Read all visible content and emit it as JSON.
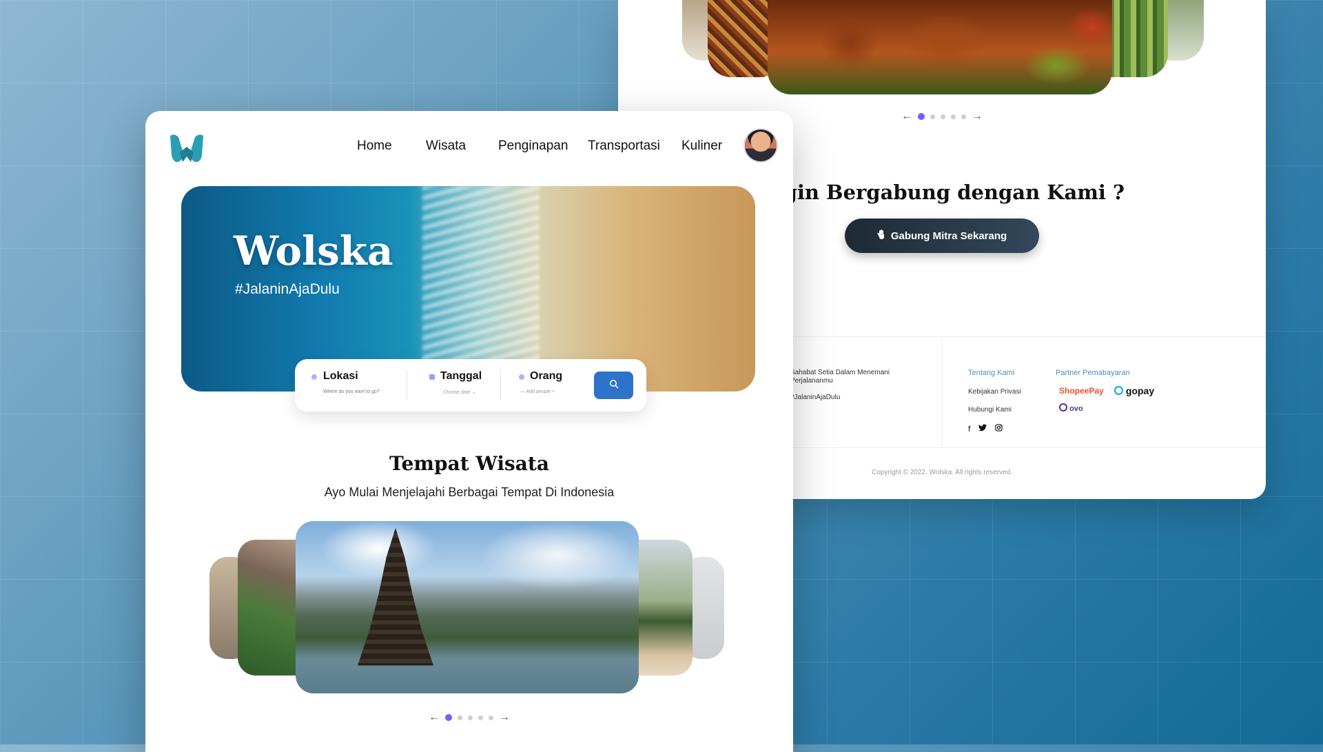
{
  "hero": {
    "title": "Wolska",
    "hashtag": "#JalaninAjaDulu"
  },
  "nav": {
    "items": [
      "Home",
      "Wisata",
      "Penginapan",
      "Transportasi",
      "Kuliner"
    ]
  },
  "search": {
    "location_label": "Lokasi",
    "location_placeholder": "Where do you want to go?",
    "date_label": "Tanggal",
    "date_placeholder": "Choose date",
    "people_label": "Orang",
    "people_placeholder": "Add people"
  },
  "section": {
    "title": "Tempat Wisata",
    "subtitle": "Ayo Mulai Menjelajahi Berbagai Tempat Di Indonesia"
  },
  "carousel": {
    "prev_arrow": "←",
    "next_arrow": "→",
    "pages": 5,
    "active_index": 0
  },
  "join": {
    "title": "Ingin Bergabung dengan Kami ?",
    "button_label": "Gabung Mitra Sekarang"
  },
  "footer": {
    "tagline": "Sahabat Setia Dalam Menemani Perjalananmu",
    "hashtag": "#JalaninAjaDulu",
    "links": [
      "Tentang Kami",
      "Kebijakan Privasi",
      "Hubungi Kami"
    ],
    "partner_title": "Partner Pemabayaran",
    "payments": [
      "ShopeePay",
      "gopay",
      "ovo"
    ],
    "social_icons": [
      "facebook-icon",
      "twitter-icon",
      "instagram-icon"
    ],
    "copyright": "Copyright © 2022. Wolska. All rights reserved."
  },
  "colors": {
    "accent_dot": "#6c63ff",
    "search_button": "#2d73c9",
    "join_button": "#1e2a33",
    "footer_link_title": "#4a8fb8",
    "logo_teal": "#2a9fb1"
  }
}
